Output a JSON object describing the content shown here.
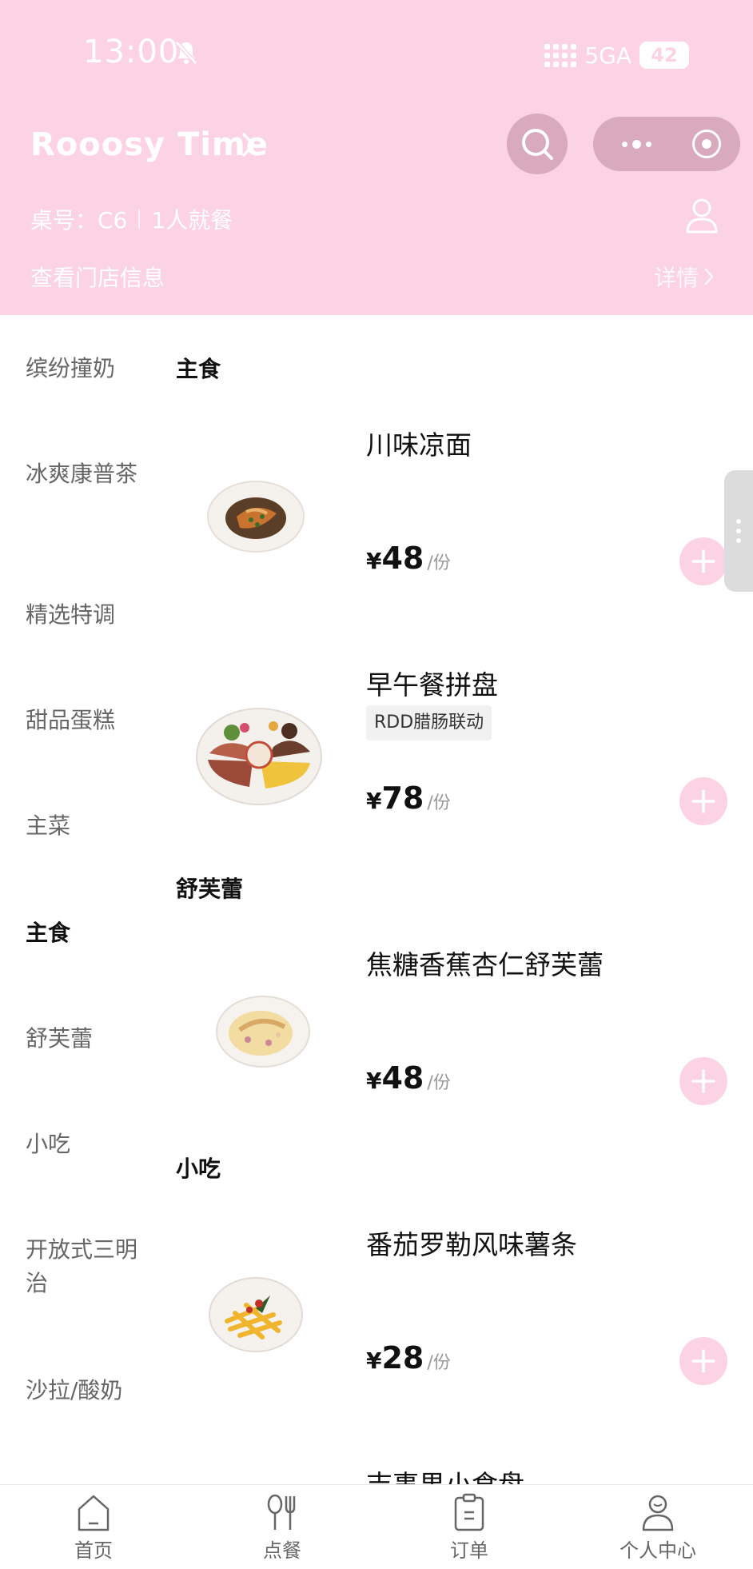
{
  "status_bar": {
    "time": "13:00",
    "network": "5GA",
    "battery": "42"
  },
  "header": {
    "store_name": "Rooosy Time",
    "table_label": "桌号：C6",
    "diners": "1人就餐",
    "store_info_link": "查看门店信息",
    "detail_link": "详情"
  },
  "sidebar": {
    "categories": [
      {
        "label": "缤纷撞奶"
      },
      {
        "label": "冰爽康普茶"
      },
      {
        "label": "精选特调"
      },
      {
        "label": "甜品蛋糕"
      },
      {
        "label": "主菜"
      },
      {
        "label": "主食"
      },
      {
        "label": "舒芙蕾"
      },
      {
        "label": "小吃"
      },
      {
        "label": "开放式三明治"
      },
      {
        "label": "沙拉/酸奶"
      }
    ],
    "active": "主食"
  },
  "menu": {
    "sections": [
      {
        "title": "主食"
      },
      {
        "title": "舒芙蕾"
      },
      {
        "title": "小吃"
      }
    ],
    "dishes": [
      {
        "name": "川味凉面",
        "currency": "¥",
        "price": "48",
        "unit": "/份",
        "tag": ""
      },
      {
        "name": "早午餐拼盘",
        "currency": "¥",
        "price": "78",
        "unit": "/份",
        "tag": "RDD腊肠联动"
      },
      {
        "name": "焦糖香蕉杏仁舒芙蕾",
        "currency": "¥",
        "price": "48",
        "unit": "/份",
        "tag": ""
      },
      {
        "name": "番茄罗勒风味薯条",
        "currency": "¥",
        "price": "28",
        "unit": "/份",
        "tag": ""
      }
    ],
    "partial_item": "吉事果小食盘"
  },
  "tabbar": {
    "items": [
      {
        "label": "首页"
      },
      {
        "label": "点餐"
      },
      {
        "label": "订单"
      },
      {
        "label": "个人中心"
      }
    ]
  },
  "colors": {
    "theme_pink": "#fbd3e4",
    "button_pink": "#d9a9bd"
  }
}
